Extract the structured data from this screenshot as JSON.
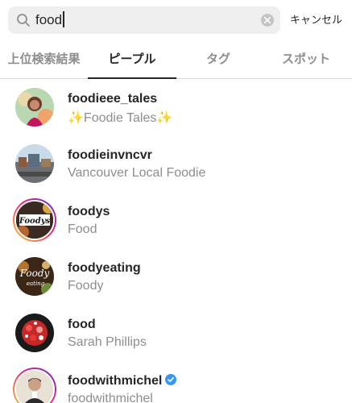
{
  "search": {
    "value": "food",
    "cancel_label": "キャンセル"
  },
  "tabs": [
    {
      "label": "上位検索結果",
      "active": false
    },
    {
      "label": "ピープル",
      "active": true
    },
    {
      "label": "タグ",
      "active": false
    },
    {
      "label": "スポット",
      "active": false
    }
  ],
  "results": [
    {
      "username": "foodieee_tales",
      "subtitle": "✨Foodie Tales✨",
      "story_ring": false,
      "verified": false
    },
    {
      "username": "foodieinvncvr",
      "subtitle": "Vancouver Local Foodie",
      "story_ring": false,
      "verified": false
    },
    {
      "username": "foodys",
      "subtitle": "Food",
      "story_ring": true,
      "verified": false,
      "avatar_text": "Foodys"
    },
    {
      "username": "foodyeating",
      "subtitle": "Foody",
      "story_ring": false,
      "verified": false,
      "avatar_text": "Foody"
    },
    {
      "username": "food",
      "subtitle": "Sarah Phillips",
      "story_ring": false,
      "verified": false
    },
    {
      "username": "foodwithmichel",
      "subtitle": "foodwithmichel",
      "story_ring": true,
      "verified": true
    }
  ],
  "colors": {
    "verified_badge": "#3897f0",
    "story_ring_start": "#f9ce34",
    "story_ring_end": "#6228d7",
    "secondary_text": "#8e8e8e"
  },
  "icons": {
    "search": "search-icon",
    "clear": "clear-icon",
    "verified": "verified-badge-icon"
  }
}
